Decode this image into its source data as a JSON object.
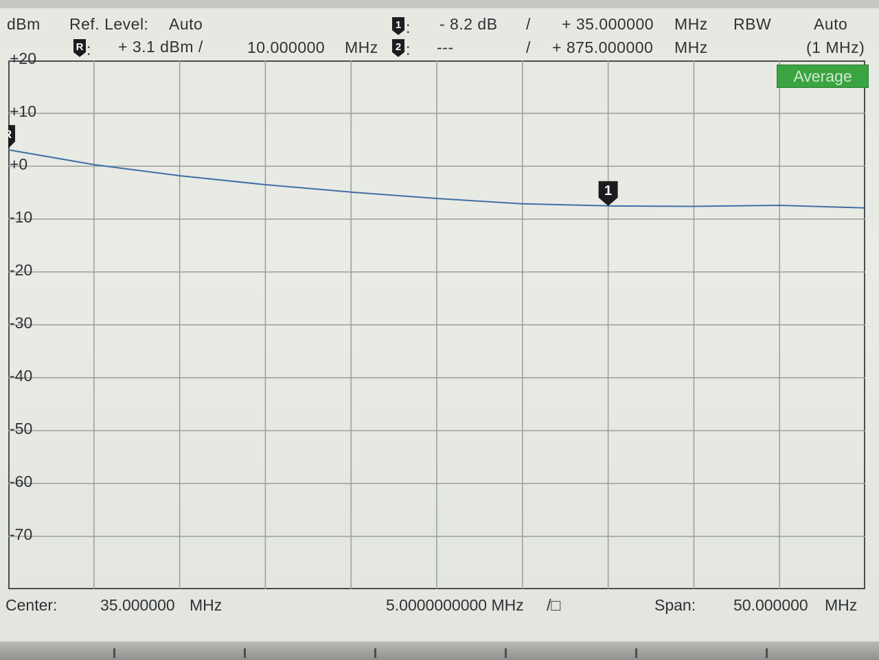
{
  "header": {
    "unit": "dBm",
    "ref_level_label": "Ref. Level:",
    "ref_level_value": "Auto",
    "r_value": "+ 3.1 dBm /",
    "r_freq": "10.000000",
    "r_freq_unit": "MHz",
    "m1_value": "- 8.2 dB",
    "m1_sep": "/",
    "m1_freq": "+ 35.000000",
    "m1_freq_unit": "MHz",
    "m2_value": "---",
    "m2_sep": "/",
    "m2_freq": "+ 875.000000",
    "m2_freq_unit": "MHz",
    "rbw_label": "RBW",
    "rbw_value": "Auto",
    "rbw_sub": "(1 MHz)"
  },
  "markers": {
    "m1_label": "1",
    "m2_label": "2",
    "r_label": "R"
  },
  "badge": "Average",
  "y_ticks": [
    "+20",
    "+10",
    "+0",
    "-10",
    "-20",
    "-30",
    "-40",
    "-50",
    "-60",
    "-70"
  ],
  "footer": {
    "center_label": "Center:",
    "center_value": "35.000000",
    "center_unit": "MHz",
    "div_value": "5.0000000000 MHz",
    "div_unit": "/□",
    "span_label": "Span:",
    "span_value": "50.000000",
    "span_unit": "MHz"
  },
  "colors": {
    "trace": "#3f6fa3",
    "grid": "#9a9d9a",
    "badge": "#3aa441"
  },
  "chart_data": {
    "type": "line",
    "xlim": [
      10,
      60
    ],
    "ylim": [
      -80,
      20
    ],
    "x_unit": "MHz",
    "y_unit": "dBm",
    "grid": true,
    "series": [
      {
        "x": [
          10,
          15,
          20,
          25,
          30,
          35,
          40,
          45,
          50,
          55,
          60
        ],
        "values": [
          3.1,
          0.3,
          -1.8,
          -3.5,
          -4.9,
          -6.1,
          -7.1,
          -7.5,
          -7.6,
          -7.4,
          -7.9
        ]
      }
    ],
    "marker_1": {
      "x": 45,
      "y": -7.5
    }
  }
}
